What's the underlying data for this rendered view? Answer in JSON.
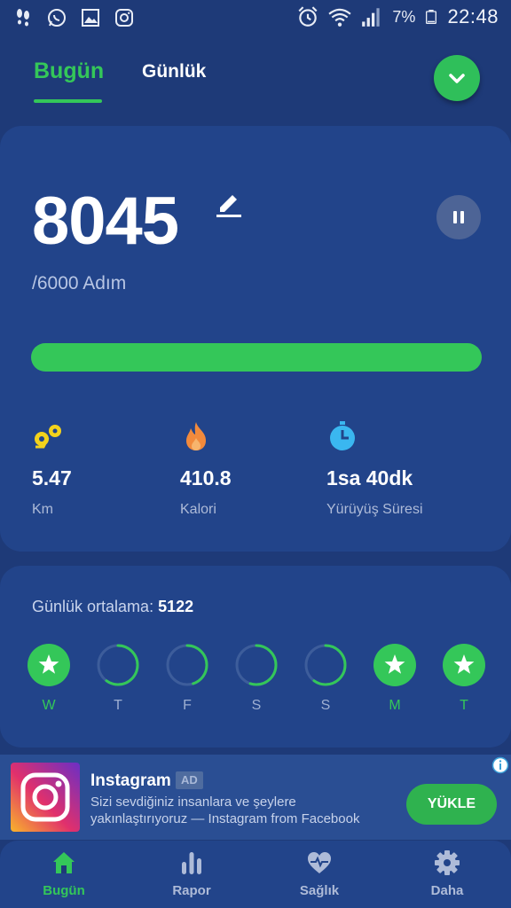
{
  "status_bar": {
    "left_icons": [
      "footsteps-icon",
      "whatsapp-icon",
      "gallery-icon",
      "instagram-icon"
    ],
    "right_icons": [
      "alarm-icon",
      "wifi-icon",
      "signal-icon",
      "battery-icon"
    ],
    "battery": "7%",
    "time": "22:48"
  },
  "tabs": {
    "today": "Bugün",
    "daily": "Günlük"
  },
  "steps": {
    "value": "8045",
    "goal": "/6000 Adım",
    "progress": 1.0
  },
  "stats": [
    {
      "icon": "distance-icon",
      "value": "5.47",
      "label": "Km"
    },
    {
      "icon": "fire-icon",
      "value": "410.8",
      "label": "Kalori"
    },
    {
      "icon": "stopwatch-icon",
      "value": "1sa 40dk",
      "label": "Yürüyüş Süresi"
    }
  ],
  "week": {
    "avg_label": "Günlük ortalama:",
    "avg_value": "5122",
    "days": [
      {
        "label": "W",
        "done": true,
        "progress": 1.0
      },
      {
        "label": "T",
        "done": false,
        "progress": 0.6
      },
      {
        "label": "F",
        "done": false,
        "progress": 0.45
      },
      {
        "label": "S",
        "done": false,
        "progress": 0.55
      },
      {
        "label": "S",
        "done": false,
        "progress": 0.6
      },
      {
        "label": "M",
        "done": true,
        "progress": 1.0
      },
      {
        "label": "T",
        "done": true,
        "progress": 1.0
      }
    ]
  },
  "ad": {
    "title": "Instagram",
    "badge": "AD",
    "text": "Sizi sevdiğiniz insanlara ve şeylere yakınlaştırıyoruz — Instagram from Facebook",
    "button": "YÜKLE"
  },
  "nav": [
    {
      "icon": "home-icon",
      "label": "Bugün",
      "active": true
    },
    {
      "icon": "bar-chart-icon",
      "label": "Rapor",
      "active": false
    },
    {
      "icon": "heart-pulse-icon",
      "label": "Sağlık",
      "active": false
    },
    {
      "icon": "gear-icon",
      "label": "Daha",
      "active": false
    }
  ],
  "colors": {
    "accent": "#34c759",
    "background": "#1e3a78",
    "card": "#22448a"
  }
}
